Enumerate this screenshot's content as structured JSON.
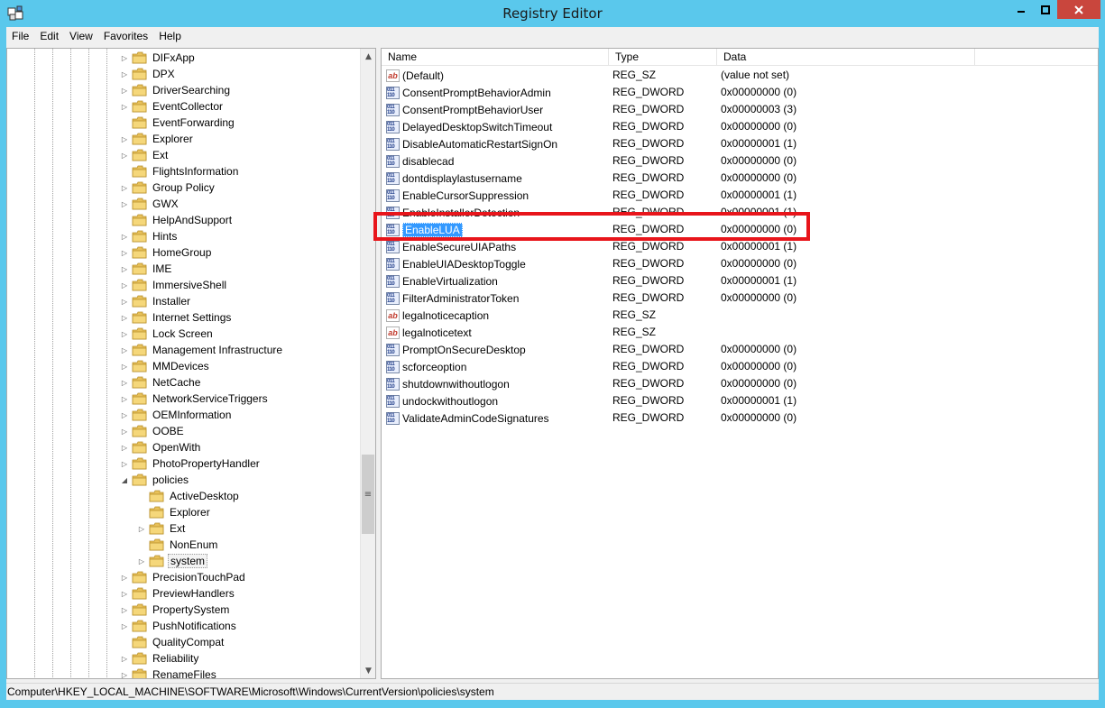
{
  "window": {
    "title": "Registry Editor"
  },
  "menu": [
    "File",
    "Edit",
    "View",
    "Favorites",
    "Help"
  ],
  "tree": [
    {
      "label": "DIFxApp",
      "expander": "collapsed",
      "indent": 0
    },
    {
      "label": "DPX",
      "expander": "collapsed",
      "indent": 0
    },
    {
      "label": "DriverSearching",
      "expander": "collapsed",
      "indent": 0
    },
    {
      "label": "EventCollector",
      "expander": "collapsed",
      "indent": 0
    },
    {
      "label": "EventForwarding",
      "expander": "none",
      "indent": 0
    },
    {
      "label": "Explorer",
      "expander": "collapsed",
      "indent": 0
    },
    {
      "label": "Ext",
      "expander": "collapsed",
      "indent": 0
    },
    {
      "label": "FlightsInformation",
      "expander": "none",
      "indent": 0
    },
    {
      "label": "Group Policy",
      "expander": "collapsed",
      "indent": 0
    },
    {
      "label": "GWX",
      "expander": "collapsed",
      "indent": 0
    },
    {
      "label": "HelpAndSupport",
      "expander": "none",
      "indent": 0
    },
    {
      "label": "Hints",
      "expander": "collapsed",
      "indent": 0
    },
    {
      "label": "HomeGroup",
      "expander": "collapsed",
      "indent": 0
    },
    {
      "label": "IME",
      "expander": "collapsed",
      "indent": 0
    },
    {
      "label": "ImmersiveShell",
      "expander": "collapsed",
      "indent": 0
    },
    {
      "label": "Installer",
      "expander": "collapsed",
      "indent": 0
    },
    {
      "label": "Internet Settings",
      "expander": "collapsed",
      "indent": 0
    },
    {
      "label": "Lock Screen",
      "expander": "collapsed",
      "indent": 0
    },
    {
      "label": "Management Infrastructure",
      "expander": "collapsed",
      "indent": 0
    },
    {
      "label": "MMDevices",
      "expander": "collapsed",
      "indent": 0
    },
    {
      "label": "NetCache",
      "expander": "collapsed",
      "indent": 0
    },
    {
      "label": "NetworkServiceTriggers",
      "expander": "collapsed",
      "indent": 0
    },
    {
      "label": "OEMInformation",
      "expander": "collapsed",
      "indent": 0
    },
    {
      "label": "OOBE",
      "expander": "collapsed",
      "indent": 0
    },
    {
      "label": "OpenWith",
      "expander": "collapsed",
      "indent": 0
    },
    {
      "label": "PhotoPropertyHandler",
      "expander": "collapsed",
      "indent": 0
    },
    {
      "label": "policies",
      "expander": "expanded",
      "indent": 0
    },
    {
      "label": "ActiveDesktop",
      "expander": "none",
      "indent": 1
    },
    {
      "label": "Explorer",
      "expander": "none",
      "indent": 1
    },
    {
      "label": "Ext",
      "expander": "collapsed",
      "indent": 1
    },
    {
      "label": "NonEnum",
      "expander": "none",
      "indent": 1
    },
    {
      "label": "system",
      "expander": "collapsed",
      "indent": 1,
      "selected": true
    },
    {
      "label": "PrecisionTouchPad",
      "expander": "collapsed",
      "indent": 0
    },
    {
      "label": "PreviewHandlers",
      "expander": "collapsed",
      "indent": 0
    },
    {
      "label": "PropertySystem",
      "expander": "collapsed",
      "indent": 0
    },
    {
      "label": "PushNotifications",
      "expander": "collapsed",
      "indent": 0
    },
    {
      "label": "QualityCompat",
      "expander": "none",
      "indent": 0
    },
    {
      "label": "Reliability",
      "expander": "collapsed",
      "indent": 0
    },
    {
      "label": "RenameFiles",
      "expander": "collapsed",
      "indent": 0
    }
  ],
  "list": {
    "columns": [
      "Name",
      "Type",
      "Data"
    ],
    "rows": [
      {
        "name": "(Default)",
        "type": "REG_SZ",
        "data": "(value not set)",
        "icon": "string-value-icon"
      },
      {
        "name": "ConsentPromptBehaviorAdmin",
        "type": "REG_DWORD",
        "data": "0x00000000 (0)",
        "icon": "dword-value-icon"
      },
      {
        "name": "ConsentPromptBehaviorUser",
        "type": "REG_DWORD",
        "data": "0x00000003 (3)",
        "icon": "dword-value-icon"
      },
      {
        "name": "DelayedDesktopSwitchTimeout",
        "type": "REG_DWORD",
        "data": "0x00000000 (0)",
        "icon": "dword-value-icon"
      },
      {
        "name": "DisableAutomaticRestartSignOn",
        "type": "REG_DWORD",
        "data": "0x00000001 (1)",
        "icon": "dword-value-icon"
      },
      {
        "name": "disablecad",
        "type": "REG_DWORD",
        "data": "0x00000000 (0)",
        "icon": "dword-value-icon"
      },
      {
        "name": "dontdisplaylastusername",
        "type": "REG_DWORD",
        "data": "0x00000000 (0)",
        "icon": "dword-value-icon"
      },
      {
        "name": "EnableCursorSuppression",
        "type": "REG_DWORD",
        "data": "0x00000001 (1)",
        "icon": "dword-value-icon"
      },
      {
        "name": "EnableInstallerDetection",
        "type": "REG_DWORD",
        "data": "0x00000001 (1)",
        "icon": "dword-value-icon"
      },
      {
        "name": "EnableLUA",
        "type": "REG_DWORD",
        "data": "0x00000000 (0)",
        "icon": "dword-value-icon",
        "selected": true
      },
      {
        "name": "EnableSecureUIAPaths",
        "type": "REG_DWORD",
        "data": "0x00000001 (1)",
        "icon": "dword-value-icon"
      },
      {
        "name": "EnableUIADesktopToggle",
        "type": "REG_DWORD",
        "data": "0x00000000 (0)",
        "icon": "dword-value-icon"
      },
      {
        "name": "EnableVirtualization",
        "type": "REG_DWORD",
        "data": "0x00000001 (1)",
        "icon": "dword-value-icon"
      },
      {
        "name": "FilterAdministratorToken",
        "type": "REG_DWORD",
        "data": "0x00000000 (0)",
        "icon": "dword-value-icon"
      },
      {
        "name": "legalnoticecaption",
        "type": "REG_SZ",
        "data": "",
        "icon": "string-value-icon"
      },
      {
        "name": "legalnoticetext",
        "type": "REG_SZ",
        "data": "",
        "icon": "string-value-icon"
      },
      {
        "name": "PromptOnSecureDesktop",
        "type": "REG_DWORD",
        "data": "0x00000000 (0)",
        "icon": "dword-value-icon"
      },
      {
        "name": "scforceoption",
        "type": "REG_DWORD",
        "data": "0x00000000 (0)",
        "icon": "dword-value-icon"
      },
      {
        "name": "shutdownwithoutlogon",
        "type": "REG_DWORD",
        "data": "0x00000000 (0)",
        "icon": "dword-value-icon"
      },
      {
        "name": "undockwithoutlogon",
        "type": "REG_DWORD",
        "data": "0x00000001 (1)",
        "icon": "dword-value-icon"
      },
      {
        "name": "ValidateAdminCodeSignatures",
        "type": "REG_DWORD",
        "data": "0x00000000 (0)",
        "icon": "dword-value-icon"
      }
    ]
  },
  "status": {
    "path": "Computer\\HKEY_LOCAL_MACHINE\\SOFTWARE\\Microsoft\\Windows\\CurrentVersion\\policies\\system"
  },
  "colors": {
    "title_bar": "#5ac8ec",
    "close_button": "#c9463d",
    "highlight_box": "#e8151b",
    "selection": "#3399ff"
  }
}
